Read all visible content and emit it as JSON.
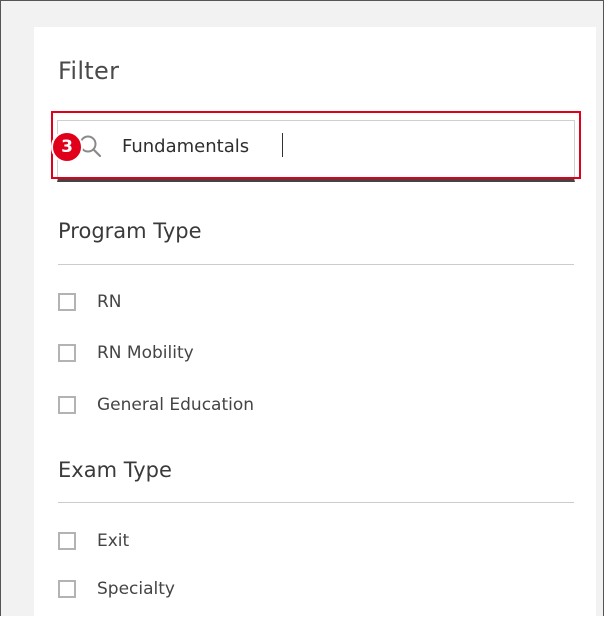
{
  "filter": {
    "title": "Filter",
    "search": {
      "value": "Fundamentals",
      "placeholder": ""
    },
    "step_marker": "3",
    "sections": [
      {
        "heading": "Program Type",
        "options": [
          {
            "label": "RN",
            "checked": false
          },
          {
            "label": "RN Mobility",
            "checked": false
          },
          {
            "label": "General Education",
            "checked": false
          }
        ]
      },
      {
        "heading": "Exam Type",
        "options": [
          {
            "label": "Exit",
            "checked": false
          },
          {
            "label": "Specialty",
            "checked": false
          }
        ]
      }
    ]
  },
  "colors": {
    "highlight": "#e0001b",
    "text": "#444444",
    "checkbox_border": "#b3b3b3"
  }
}
